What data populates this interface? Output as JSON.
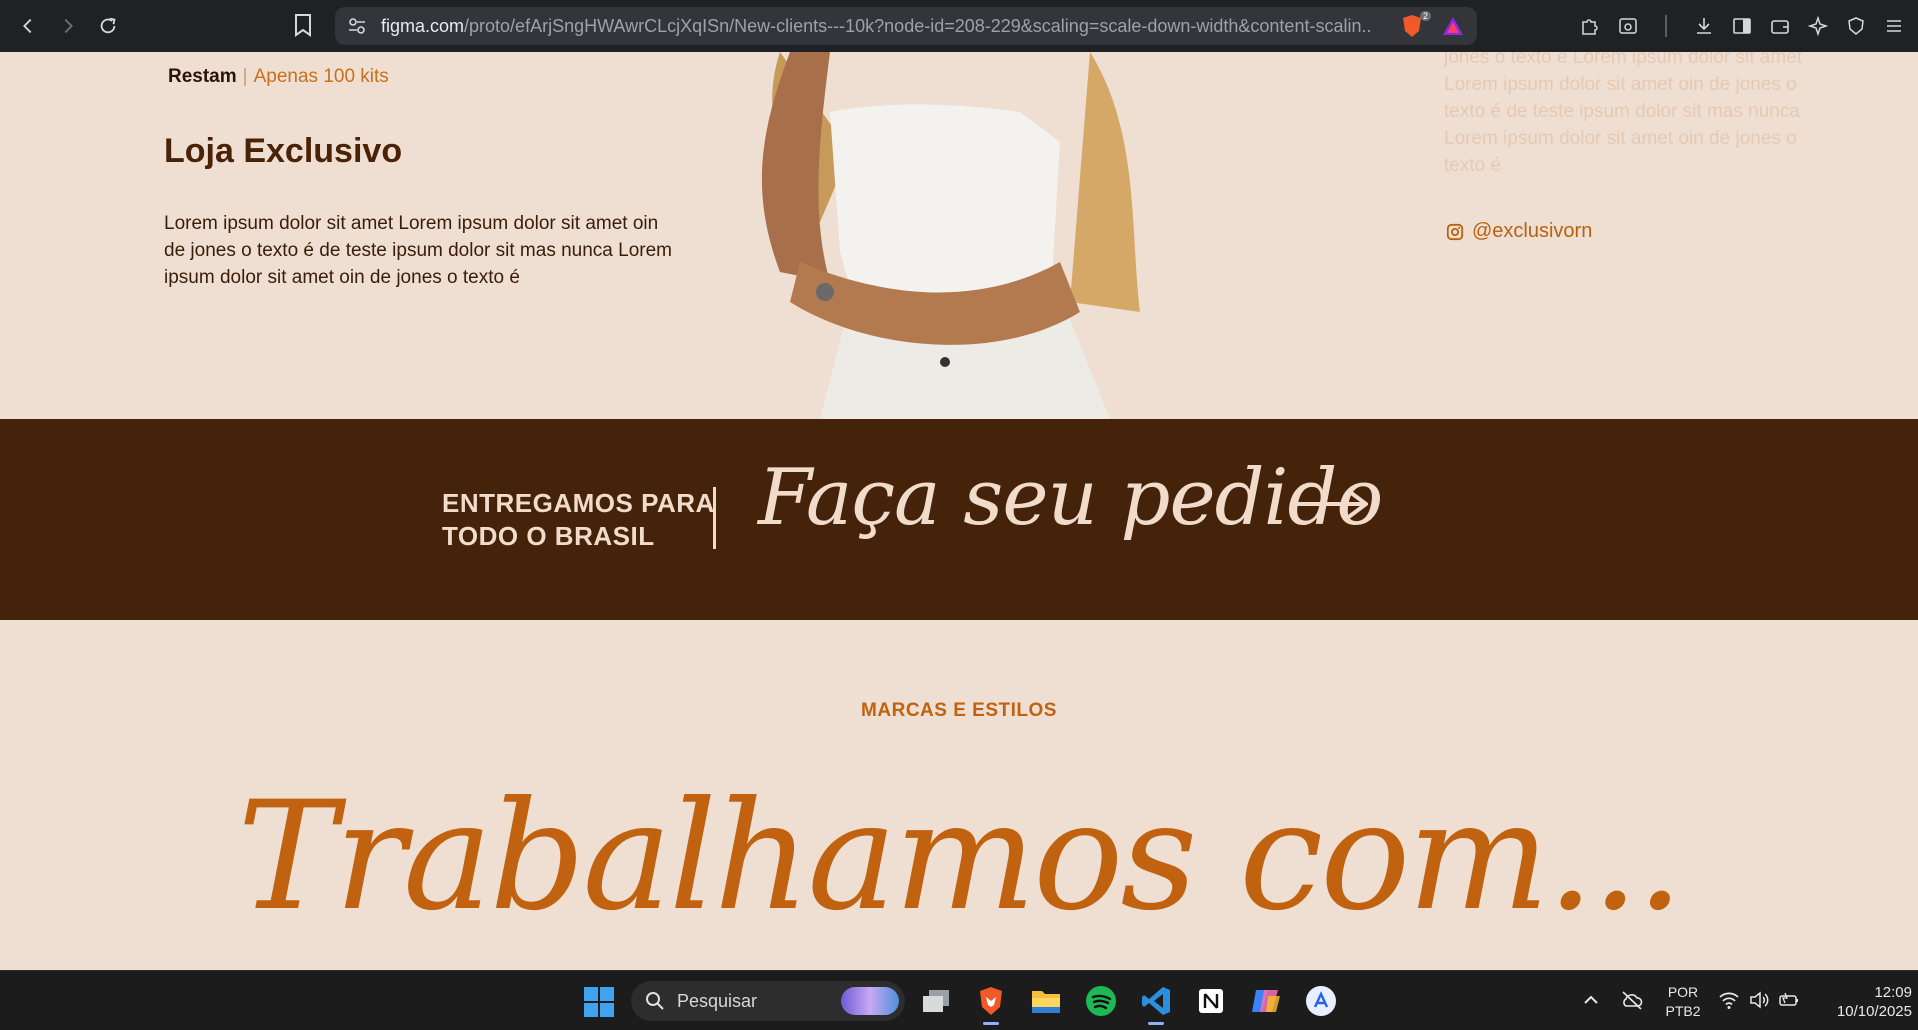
{
  "browser": {
    "url_host": "figma.com",
    "url_path": "/proto/efArjSngHWAwrCLcjXqISn/New-clients---10k?node-id=208-229&scaling=scale-down-width&content-scalin...",
    "shield_count": "2"
  },
  "page": {
    "restam_label": "Restam",
    "restam_separator": "|",
    "restam_value": "Apenas 100 kits",
    "store_title": "Loja Exclusivo",
    "store_description": "Lorem ipsum dolor sit amet Lorem ipsum dolor sit amet oin de jones o texto é de teste ipsum dolor sit mas nunca Lorem ipsum dolor sit amet  oin de jones o texto é",
    "faded_description": "jones o texto é Lorem ipsum dolor sit amet Lorem ipsum dolor sit amet  oin de jones o texto é de teste ipsum dolor sit mas nunca Lorem ipsum dolor sit amet oin de jones o texto é",
    "instagram_handle": "@exclusivorn",
    "banner_line1": "ENTREGAMOS PARA",
    "banner_line2": "TODO O BRASIL",
    "banner_cta": "Faça seu pedido",
    "section_kicker": "MARCAS E ESTILOS",
    "section_headline": "Trabalhamos com..."
  },
  "colors": {
    "page_bg": "#efdfd2",
    "banner_bg": "#45220a",
    "accent": "#c0620f",
    "heading": "#4a2208"
  },
  "taskbar": {
    "search_placeholder": "Pesquisar",
    "language_top": "POR",
    "language_bottom": "PTB2",
    "time": "12:09",
    "date": "10/10/2025",
    "apps": [
      "task-view-icon",
      "brave-icon",
      "file-explorer-icon",
      "spotify-icon",
      "vscode-icon",
      "notion-icon",
      "copilot-icon",
      "app-store-icon"
    ]
  }
}
